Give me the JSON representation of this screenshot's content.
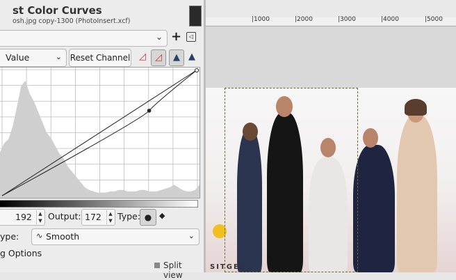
{
  "dialog": {
    "title": "st Color Curves",
    "subtitle": "osh.jpg copy-1300 (PhotoInsert.xcf)",
    "presets_placeholder": "",
    "channel": {
      "label": "Value"
    },
    "reset_label": "Reset Channel",
    "curve": {
      "points": [
        [
          0,
          0
        ],
        [
          192,
          172
        ],
        [
          255,
          255
        ]
      ],
      "type": "Smooth"
    },
    "input_label": "",
    "input_value": "192",
    "output_label": "Output:",
    "output_value": "172",
    "type_label": "Type:",
    "curve_type_row_label": "ype:",
    "curve_type_value": "Smooth",
    "options_label": "g Options",
    "split_view_label": "Split view"
  },
  "ruler": {
    "labels": [
      "|1000",
      "|2000",
      "|3000",
      "|4000",
      "|5000"
    ]
  },
  "canvas": {
    "watermark": "SITGES"
  },
  "colors": {
    "accent": "#2e6bb5",
    "panel_bg": "#ececec"
  }
}
